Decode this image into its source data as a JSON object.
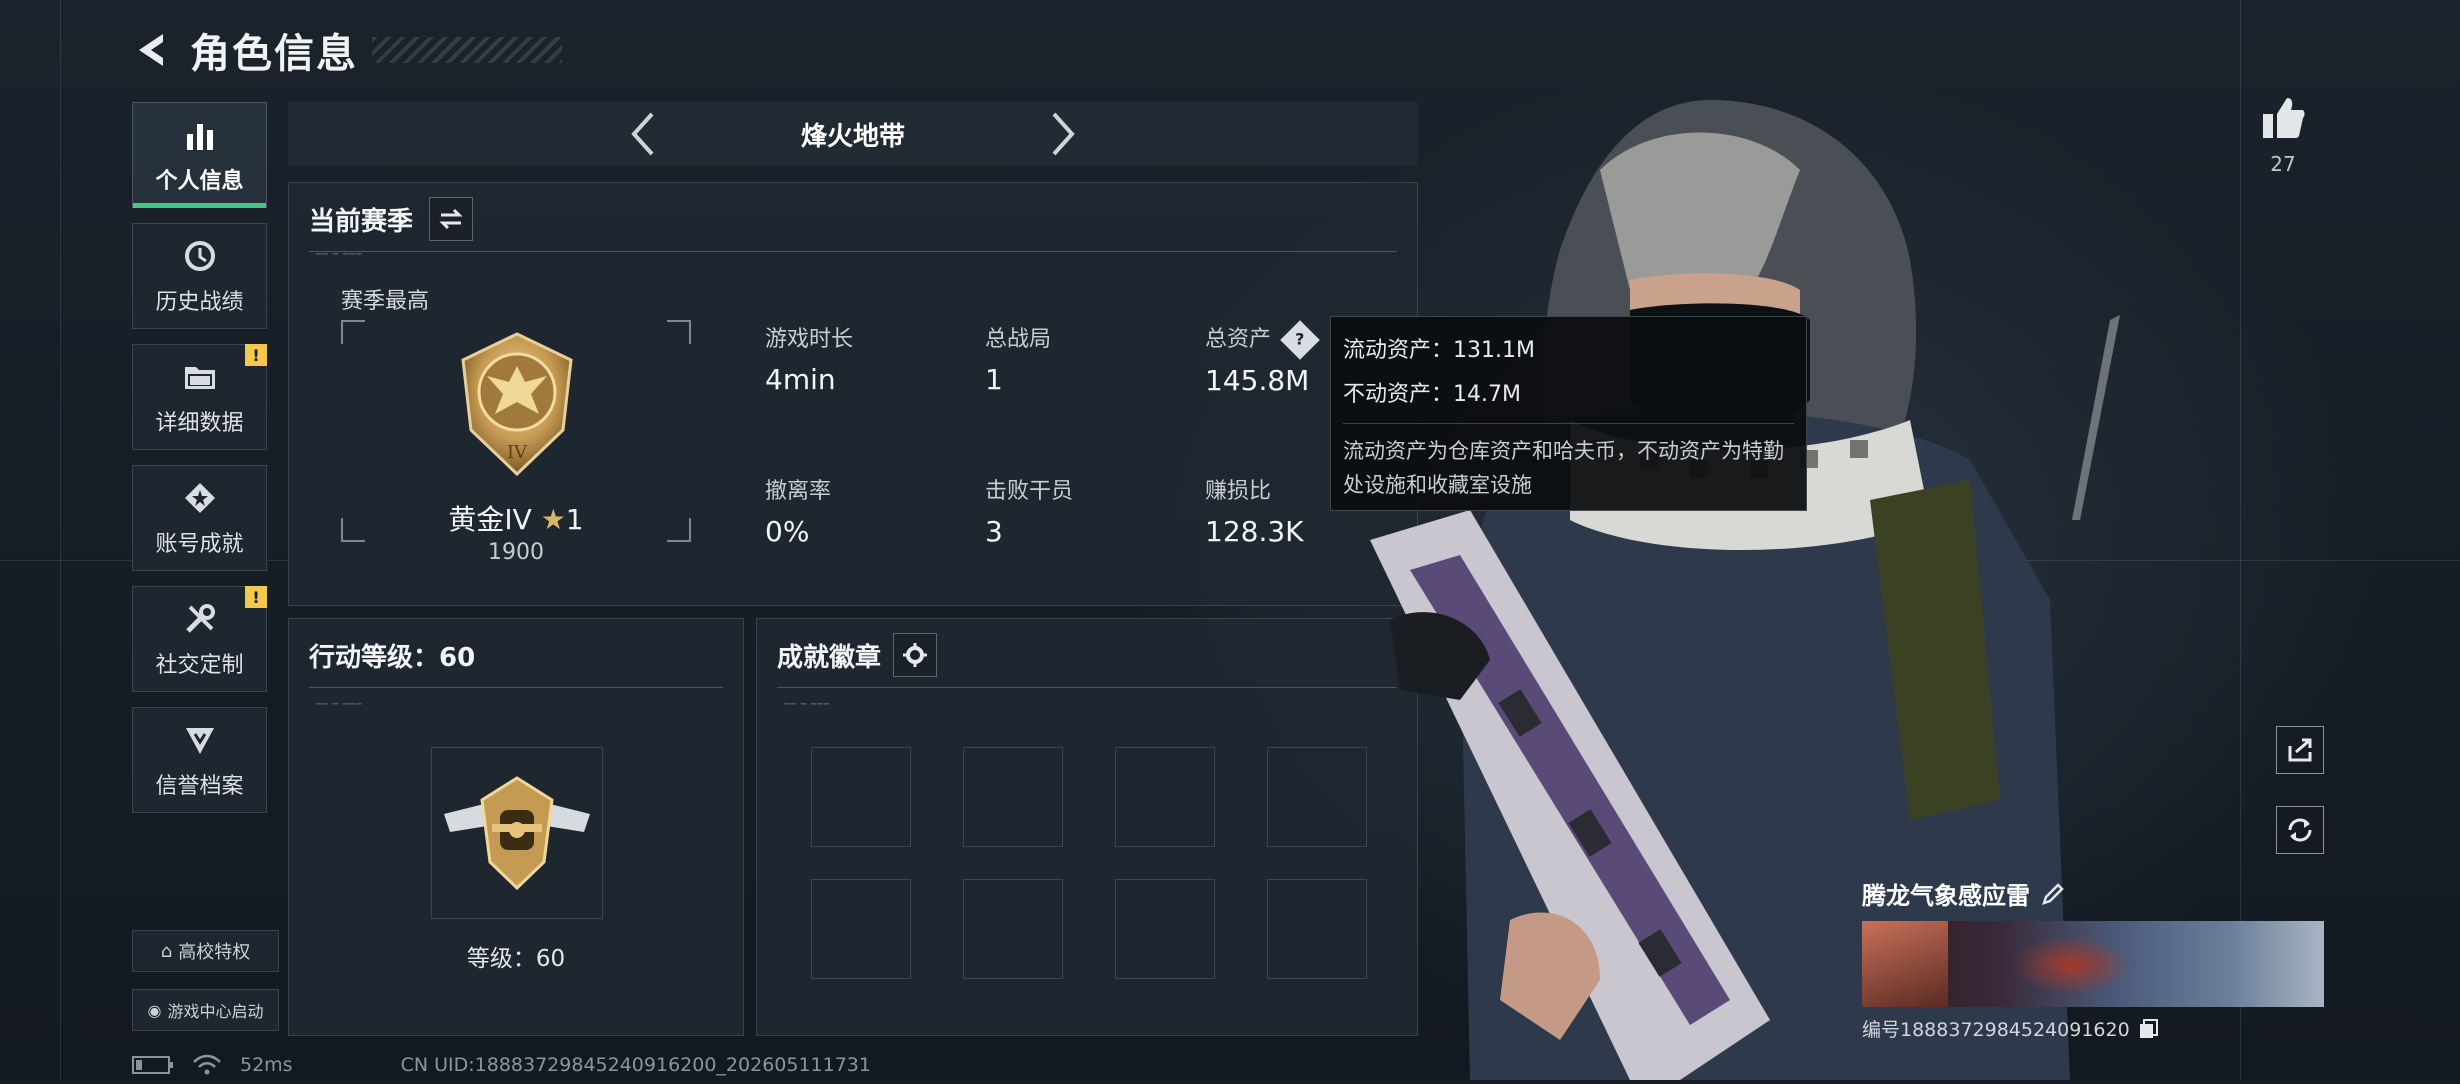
{
  "header": {
    "title": "角色信息"
  },
  "nav": [
    {
      "label": "个人信息",
      "icon": "bar-chart-icon",
      "active": true,
      "badge": ""
    },
    {
      "label": "历史战绩",
      "icon": "history-icon",
      "active": false,
      "badge": ""
    },
    {
      "label": "详细数据",
      "icon": "folder-icon",
      "active": false,
      "badge": "!"
    },
    {
      "label": "账号成就",
      "icon": "achievement-icon",
      "active": false,
      "badge": ""
    },
    {
      "label": "社交定制",
      "icon": "tools-icon",
      "active": false,
      "badge": "!"
    },
    {
      "label": "信誉档案",
      "icon": "credit-icon",
      "active": false,
      "badge": ""
    }
  ],
  "bottom_buttons": {
    "campus": "高校特权",
    "game_center": "游戏中心启动"
  },
  "mode": {
    "title": "烽火地带"
  },
  "season": {
    "title": "当前赛季",
    "best_label": "赛季最高",
    "rank_name": "黄金IV",
    "rank_stars": "1",
    "rank_score": "1900",
    "rank_numeral": "IV",
    "stats": [
      {
        "label": "游戏时长",
        "value": "4min"
      },
      {
        "label": "总战局",
        "value": "1"
      },
      {
        "label": "总资产",
        "value": "145.8M"
      },
      {
        "label": "撤离率",
        "value": "0%"
      },
      {
        "label": "击败干员",
        "value": "3"
      },
      {
        "label": "赚损比",
        "value": "128.3K"
      }
    ]
  },
  "tooltip": {
    "liquid": "流动资产：131.1M",
    "fixed": "不动资产：14.7M",
    "desc": "流动资产为仓库资产和哈夫币，不动资产为特勤处设施和收藏室设施"
  },
  "level": {
    "title": "行动等级：60",
    "label": "等级：60"
  },
  "badges": {
    "title": "成就徽章"
  },
  "profile": {
    "likes": "27",
    "name": "腾龙气象感应雷",
    "uid": "编号1888372984524091620"
  },
  "status": {
    "ping": "52ms",
    "uid_line": "CN UID:18883729845240916200_202605111731"
  },
  "colors": {
    "accent": "#41c98a",
    "badge": "#f2c94c"
  }
}
